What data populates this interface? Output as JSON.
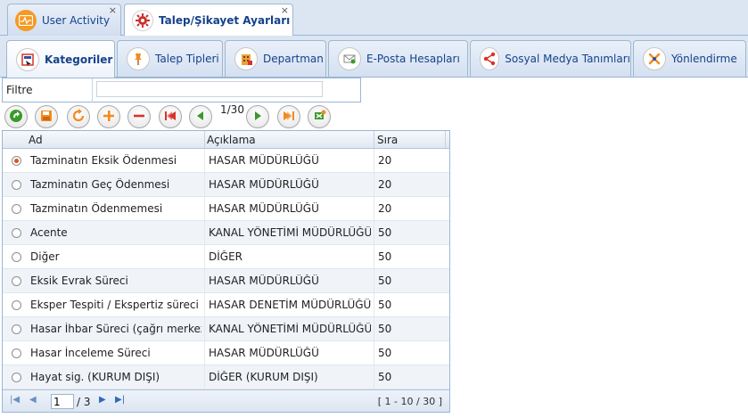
{
  "top_tabs": [
    {
      "label": "User Activity",
      "close": "×"
    },
    {
      "label": "Talep/Şikayet Ayarları",
      "close": "×"
    }
  ],
  "sub_tabs": [
    {
      "label": "Kategoriler"
    },
    {
      "label": "Talep Tipleri"
    },
    {
      "label": "Departman"
    },
    {
      "label": "E-Posta Hesapları"
    },
    {
      "label": "Sosyal Medya Tanımları"
    },
    {
      "label": "Yönlendirme"
    }
  ],
  "filter": {
    "label": "Filtre",
    "value": ""
  },
  "toolbar": {
    "page_count": "1/30"
  },
  "grid": {
    "columns": [
      "Ad",
      "Açıklama",
      "Sıra"
    ],
    "rows": [
      {
        "ad": "Tazminatın Eksik Ödenmesi",
        "aciklama": "HASAR MÜDÜRLÜĞÜ",
        "sira": "20"
      },
      {
        "ad": "Tazminatın Geç Ödenmesi",
        "aciklama": "HASAR MÜDÜRLÜĞÜ",
        "sira": "20"
      },
      {
        "ad": "Tazminatın Ödenmemesi",
        "aciklama": "HASAR MÜDÜRLÜĞÜ",
        "sira": "20"
      },
      {
        "ad": "Acente",
        "aciklama": "KANAL YÖNETİMİ MÜDÜRLÜĞÜ",
        "sira": "50"
      },
      {
        "ad": "Diğer",
        "aciklama": "DİĞER",
        "sira": "50"
      },
      {
        "ad": "Eksik Evrak Süreci",
        "aciklama": "HASAR MÜDÜRLÜĞÜ",
        "sira": "50"
      },
      {
        "ad": "Eksper Tespiti / Ekspertiz süreci",
        "aciklama": "HASAR DENETİM MÜDÜRLÜĞÜ",
        "sira": "50"
      },
      {
        "ad": "Hasar İhbar Süreci (çağrı merkezi)",
        "aciklama": "KANAL YÖNETİMİ MÜDÜRLÜĞÜ",
        "sira": "50"
      },
      {
        "ad": "Hasar İnceleme Süreci",
        "aciklama": "HASAR MÜDÜRLÜĞÜ",
        "sira": "50"
      },
      {
        "ad": "Hayat sig. (KURUM DIŞI)",
        "aciklama": "DİĞER (KURUM DIŞI)",
        "sira": "50"
      }
    ],
    "selected_row": 0
  },
  "pager": {
    "page": "1",
    "of": "/ 3",
    "info": "[ 1 - 10 / 30 ]"
  },
  "colors": {
    "accent": "#15428b",
    "border": "#99b6d6",
    "orange": "#f58a1f",
    "green": "#3a9a2a",
    "red": "#d9322a"
  }
}
